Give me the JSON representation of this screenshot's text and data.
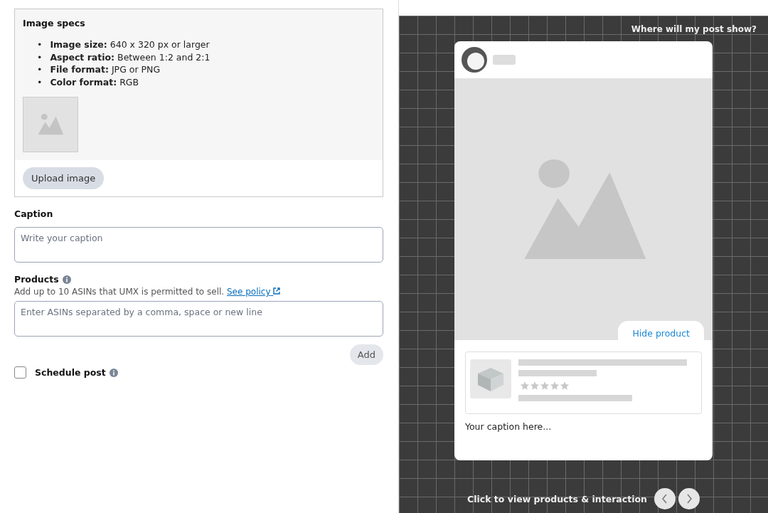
{
  "image_specs": {
    "title": "Image specs",
    "specs": [
      {
        "bullet": "•",
        "label": "Image size:",
        "value": "640 x 320 px or larger"
      },
      {
        "bullet": "•",
        "label": "Aspect ratio:",
        "value": "Between 1:2 and 2:1"
      },
      {
        "bullet": "•",
        "label": "File format:",
        "value": "JPG or PNG"
      },
      {
        "bullet": "•",
        "label": "Color format:",
        "value": "RGB"
      }
    ],
    "upload_button": "Upload image"
  },
  "caption": {
    "label": "Caption",
    "placeholder": "Write your caption"
  },
  "products": {
    "label": "Products",
    "hint": "Add up to 10 ASINs that UMX is permitted to sell.",
    "link": "See policy",
    "placeholder": "Enter ASINs separated by a comma, space or new line",
    "add_button": "Add"
  },
  "schedule": {
    "label": "Schedule post",
    "checked": false
  },
  "preview": {
    "help_link": "Where will my post show?",
    "hide_product": "Hide product",
    "caption": "Your caption here...",
    "footer": "Click to view products & interaction"
  }
}
